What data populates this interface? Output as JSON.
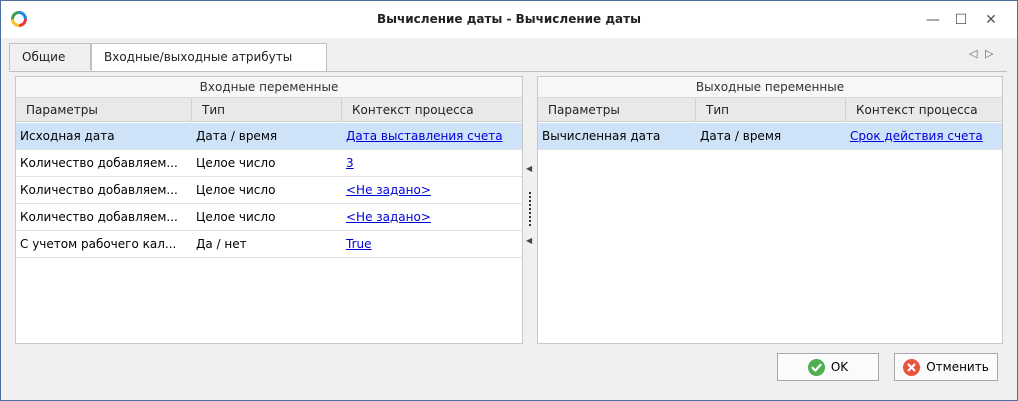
{
  "window": {
    "title": "Вычисление даты - Вычисление даты",
    "buttons": {
      "minimize": "—",
      "maximize": "☐",
      "close": "✕"
    }
  },
  "tabs": [
    {
      "label": "Общие",
      "active": false
    },
    {
      "label": "Входные/выходные атрибуты",
      "active": true
    }
  ],
  "tab_nav": {
    "prev": "◁",
    "next": "▷"
  },
  "input_table": {
    "group_header": "Входные переменные",
    "columns": [
      "Параметры",
      "Тип",
      "Контекст процесса"
    ],
    "rows": [
      {
        "param": "Исходная дата",
        "type": "Дата / время",
        "context": "Дата выставления счета",
        "selected": true
      },
      {
        "param": "Количество добавляем...",
        "type": "Целое число",
        "context": "3",
        "selected": false
      },
      {
        "param": "Количество добавляем...",
        "type": "Целое число",
        "context": "<Не задано>",
        "selected": false
      },
      {
        "param": "Количество добавляем...",
        "type": "Целое число",
        "context": "<Не задано>",
        "selected": false
      },
      {
        "param": "С учетом рабочего кал...",
        "type": "Да / нет",
        "context": "True",
        "selected": false
      }
    ]
  },
  "output_table": {
    "group_header": "Выходные переменные",
    "columns": [
      "Параметры",
      "Тип",
      "Контекст процесса"
    ],
    "rows": [
      {
        "param": "Вычисленная дата",
        "type": "Дата / время",
        "context": "Срок действия счета",
        "selected": true
      }
    ]
  },
  "splitter": {
    "arrow_top": "◀",
    "arrow_bottom": "◀"
  },
  "footer": {
    "ok_label": "OK",
    "cancel_label": "Отменить"
  },
  "colors": {
    "selected_row": "#cfe3f8",
    "link": "#0000dd",
    "ok_icon": "#4caf50",
    "cancel_icon": "#e8553b"
  }
}
